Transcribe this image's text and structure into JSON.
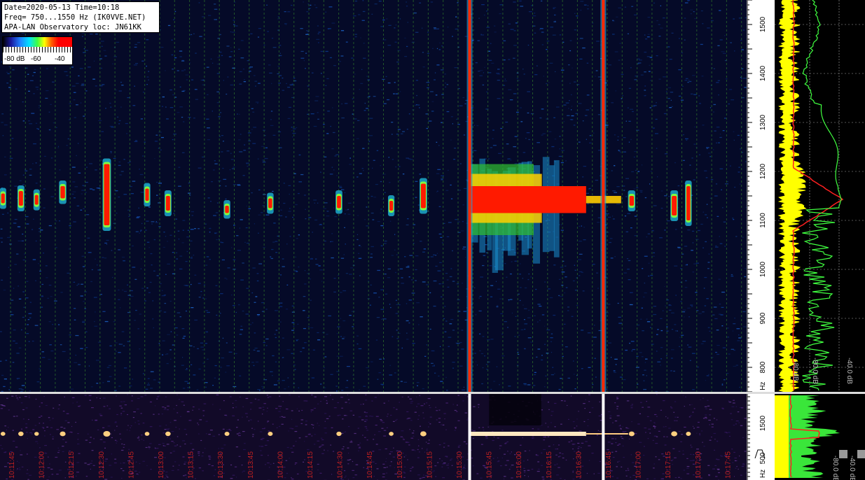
{
  "header": {
    "line1": "Date=2020-05-13 Time=10:18",
    "line2": "Freq= 750...1550 Hz (IK0VVE.NET)",
    "line3": "APA-LAN Observatory loc: JN61KK"
  },
  "scale": {
    "min_label": "-80 dB",
    "mid_label": "-60",
    "max_label": "-40"
  },
  "colors": {
    "background": "#050a28",
    "signal": "#ff0000",
    "grid": "#2a6a2a",
    "time_label": "#c02020",
    "avg_trace": "#ffff00",
    "peak_trace": "#00ff00",
    "mean_trace": "#ff2020"
  },
  "chart_data": {
    "type": "heatmap",
    "title": "",
    "y_unit": "Hz",
    "y_range": [
      750,
      1550
    ],
    "y_ticks": [
      {
        "value": 1500,
        "label": "1500"
      },
      {
        "value": 1400,
        "label": "1400"
      },
      {
        "value": 1300,
        "label": "1300"
      },
      {
        "value": 1200,
        "label": "1200"
      },
      {
        "value": 1100,
        "label": "1100"
      },
      {
        "value": 1000,
        "label": "1000"
      },
      {
        "value": 900,
        "label": "900"
      },
      {
        "value": 800,
        "label": "800"
      }
    ],
    "y_unit_label": "Hz",
    "x_labels": [
      "10:11:45",
      "10:12:00",
      "10:12:15",
      "10:12:30",
      "10:12:45",
      "10:13:00",
      "10:13:15",
      "10:13:30",
      "10:13:45",
      "10:14:00",
      "10:14:15",
      "10:14:30",
      "10:14:45",
      "10:15:00",
      "10:15:15",
      "10:15:30",
      "10:15:45",
      "10:16:00",
      "10:16:15",
      "10:16:30",
      "10:16:45",
      "10:17:00",
      "10:17:15",
      "10:17:30",
      "10:17:45"
    ],
    "sub_y_ticks": [
      {
        "value": 1500,
        "label": "1500"
      },
      {
        "value": 500,
        "label": "500"
      }
    ],
    "sub_y_unit_label": "Hz",
    "carrier_freq_hz": 1143,
    "echoes": [
      {
        "t": 0.004,
        "f_lo": 1135,
        "f_hi": 1155,
        "strength": 0.45
      },
      {
        "t": 0.028,
        "f_lo": 1130,
        "f_hi": 1160,
        "strength": 0.6
      },
      {
        "t": 0.049,
        "f_lo": 1132,
        "f_hi": 1152,
        "strength": 0.4
      },
      {
        "t": 0.084,
        "f_lo": 1145,
        "f_hi": 1170,
        "strength": 0.7
      },
      {
        "t": 0.143,
        "f_lo": 1090,
        "f_hi": 1215,
        "strength": 1.0
      },
      {
        "t": 0.197,
        "f_lo": 1140,
        "f_hi": 1165,
        "strength": 0.45
      },
      {
        "t": 0.225,
        "f_lo": 1120,
        "f_hi": 1150,
        "strength": 0.6
      },
      {
        "t": 0.304,
        "f_lo": 1115,
        "f_hi": 1130,
        "strength": 0.5
      },
      {
        "t": 0.362,
        "f_lo": 1125,
        "f_hi": 1145,
        "strength": 0.5
      },
      {
        "t": 0.454,
        "f_lo": 1125,
        "f_hi": 1150,
        "strength": 0.55
      },
      {
        "t": 0.524,
        "f_lo": 1120,
        "f_hi": 1140,
        "strength": 0.45
      },
      {
        "t": 0.567,
        "f_lo": 1125,
        "f_hi": 1175,
        "strength": 0.8
      },
      {
        "t": 0.846,
        "f_lo": 1130,
        "f_hi": 1150,
        "strength": 0.7
      },
      {
        "t": 0.903,
        "f_lo": 1110,
        "f_hi": 1150,
        "strength": 0.8
      },
      {
        "t": 0.922,
        "f_lo": 1100,
        "f_hi": 1170,
        "strength": 0.5
      }
    ],
    "broadband_lines": [
      {
        "t": 0.629,
        "f_lo": 750,
        "f_hi": 1550,
        "strength": 1.0
      },
      {
        "t": 0.808,
        "f_lo": 750,
        "f_hi": 1550,
        "strength": 1.0
      }
    ],
    "long_echo": {
      "t_start": 0.629,
      "t_end": 0.785,
      "f_lo": 1115,
      "f_hi": 1170,
      "plume_f_lo": 1010,
      "plume_f_hi": 1230
    },
    "side_panel": {
      "labels": [
        "-80 dB",
        "-80.0 dB",
        "-40.0 dB"
      ],
      "sub_labels": [
        "-80.0 dB",
        "-40.0 dB"
      ],
      "mean_peak_hz": 1143
    }
  }
}
